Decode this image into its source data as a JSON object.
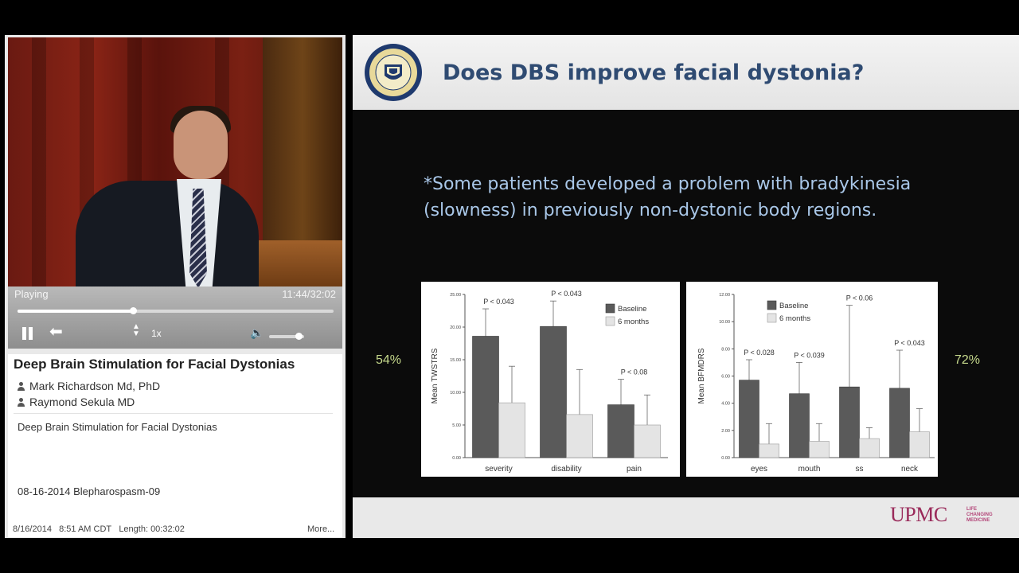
{
  "player": {
    "status": "Playing",
    "time": "11:44/32:02",
    "progress": 0.366,
    "rate_label": "1x",
    "volume_level": 0.85,
    "icons": [
      "pause-icon",
      "rewind-icon",
      "rate-arrows-icon",
      "volume-icon"
    ]
  },
  "info": {
    "title": "Deep Brain Stimulation for Facial Dystonias",
    "presenters": [
      "Mark Richardson Md, PhD",
      "Raymond Sekula MD"
    ],
    "description": "Deep Brain Stimulation for Facial Dystonias",
    "tag": "08-16-2014 Blepharospasm-09",
    "date": "8/16/2014",
    "time": "8:51 AM CDT",
    "length": "Length: 00:32:02",
    "more_label": "More..."
  },
  "slide": {
    "title": "Does DBS improve facial dystonia?",
    "note": "*Some patients developed a problem with bradykinesia (slowness) in previously non-dystonic body regions.",
    "pct_left": "54%",
    "pct_right": "72%",
    "logo_text": "UPMC",
    "logo_tagline": [
      "LIFE",
      "CHANGING",
      "MEDICINE"
    ]
  },
  "colors": {
    "slide_title": "#2f4b72",
    "note_text": "#a9c7e8",
    "percent": "#c6d98c",
    "upmc": "#9a2a5a",
    "bar_baseline": "#5a5a5a",
    "bar_6months": "#e4e4e4"
  },
  "chart_data": [
    {
      "type": "bar",
      "ylabel": "Mean TWSTRS",
      "ylim": [
        0,
        25
      ],
      "yticks": [
        "0.00",
        "5.00",
        "10.00",
        "15.00",
        "20.00",
        "25.00"
      ],
      "categories": [
        "severity",
        "disability",
        "pain"
      ],
      "series": [
        {
          "name": "Baseline",
          "values": [
            18.6,
            20.1,
            8.1
          ],
          "err_high": [
            22.8,
            24.0,
            12.0
          ]
        },
        {
          "name": "6 months",
          "values": [
            8.4,
            6.6,
            5.0
          ],
          "err_high": [
            14.0,
            13.5,
            9.6
          ]
        }
      ],
      "annotations": [
        "P < 0.043",
        "P < 0.043",
        "P < 0.08"
      ],
      "legend": "top-right"
    },
    {
      "type": "bar",
      "ylabel": "Mean BFMDRS",
      "ylim": [
        0,
        12
      ],
      "yticks": [
        "0.00",
        "2.00",
        "4.00",
        "6.00",
        "8.00",
        "10.00",
        "12.00"
      ],
      "categories": [
        "eyes",
        "mouth",
        "ss",
        "neck"
      ],
      "series": [
        {
          "name": "Baseline",
          "values": [
            5.7,
            4.7,
            5.2,
            5.1
          ],
          "err_high": [
            7.2,
            7.0,
            11.2,
            7.9
          ]
        },
        {
          "name": "6 months",
          "values": [
            1.0,
            1.2,
            1.4,
            1.9
          ],
          "err_high": [
            2.5,
            2.5,
            2.2,
            3.6
          ]
        }
      ],
      "annotations": [
        "P < 0.028",
        "P < 0.039",
        "P < 0.06",
        "P < 0.043"
      ],
      "legend": "top-left"
    }
  ]
}
